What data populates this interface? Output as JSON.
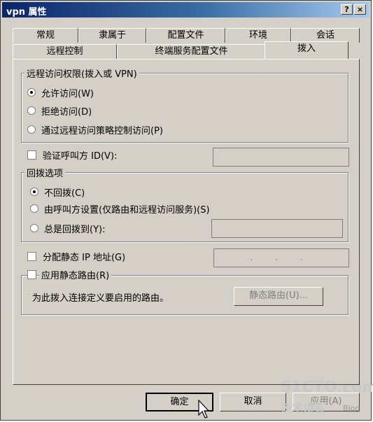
{
  "window": {
    "title": "vpn 属性",
    "help_button": "?",
    "close_button": "×"
  },
  "tabs_row1": [
    "常规",
    "隶属于",
    "配置文件",
    "环境",
    "会话"
  ],
  "tabs_row2": [
    "远程控制",
    "终端服务配置文件",
    "拨入"
  ],
  "active_tab": "拨入",
  "remote_access": {
    "legend": "远程访问权限(拨入或 VPN)",
    "options": [
      "允许访问(W)",
      "拒绝访问(D)",
      "通过远程访问策略控制访问(P)"
    ],
    "selected": "允许访问(W)"
  },
  "verify_caller_id": {
    "label": "验证呼叫方 ID(V):",
    "checked": false,
    "value": ""
  },
  "callback": {
    "legend": "回拨选项",
    "options": [
      "不回拨(C)",
      "由呼叫方设置(仅路由和远程访问服务)(S)",
      "总是回拨到(Y):"
    ],
    "selected": "不回拨(C)",
    "number_value": ""
  },
  "static_ip": {
    "label": "分配静态 IP 地址(G)",
    "checked": false,
    "ip_value": ". . ."
  },
  "static_routes": {
    "label": "应用静态路由(R)",
    "checked": false,
    "description": "为此拨入连接定义要启用的路由。",
    "button_label": "静态路由(U)..."
  },
  "footer": {
    "ok_label": "确定",
    "cancel_label": "取消",
    "apply_label": "应用(A)"
  },
  "watermark": {
    "site": "51CTO.com",
    "text": "技术博客",
    "blog": "Blog"
  },
  "colors": {
    "dialog_bg": "#d4d0c8",
    "title_start": "#0a246a",
    "title_end": "#a6caf0"
  }
}
